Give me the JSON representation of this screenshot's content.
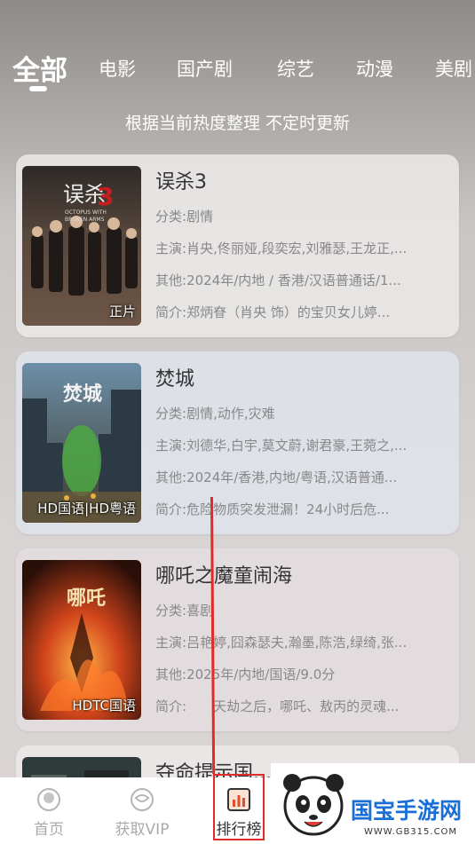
{
  "tabs": [
    "全部",
    "电影",
    "国产剧",
    "综艺",
    "动漫",
    "美剧"
  ],
  "subtitle": "根据当前热度整理 不定时更新",
  "cards": [
    {
      "title": "误杀3",
      "badge": "正片",
      "category_label": "分类:",
      "category": "剧情",
      "cast_label": "主演:",
      "cast": "肖央,佟丽娅,段奕宏,刘雅瑟,王龙正,...",
      "other_label": "其他:",
      "other": "2024年/内地 / 香港/汉语普通话/1...",
      "intro_label": "简介:",
      "intro": "郑炳眘（肖央 饰）的宝贝女儿婷...",
      "poster_text": "误杀",
      "poster_sub": "OCTOPUS WITH BROKEN ARMS",
      "colors": {
        "top": "#2e2a28",
        "bottom": "#8a6a55",
        "accent": "#c61e1e"
      }
    },
    {
      "title": "焚城",
      "badge": "HD国语|HD粤语",
      "category_label": "分类:",
      "category": "剧情,动作,灾难",
      "cast_label": "主演:",
      "cast": "刘德华,白宇,莫文蔚,谢君豪,王菀之,...",
      "other_label": "其他:",
      "other": "2024年/香港,内地/粤语,汉语普通...",
      "intro_label": "简介:",
      "intro": "危险物质突发泄漏！24小时后危...",
      "poster_text": "焚城",
      "colors": {
        "top": "#6d8ea8",
        "bottom": "#3b3a2b",
        "accent": "#4ea843"
      }
    },
    {
      "title": "哪吒之魔童闹海",
      "badge": "HDTC国语",
      "category_label": "分类:",
      "category": "喜剧",
      "cast_label": "主演:",
      "cast": "吕艳婷,囧森瑟夫,瀚墨,陈浩,绿绮,张...",
      "other_label": "其他:",
      "other": "2025年/内地/国语/9.0分",
      "intro_label": "简介:",
      "intro": "　　天劫之后，哪吒、敖丙的灵魂...",
      "poster_text": "哪吒",
      "colors": {
        "top": "#2a0f08",
        "bottom": "#d2451c",
        "accent": "#ffb347"
      }
    },
    {
      "title": "夺命提示国..."
    }
  ],
  "bottom_nav": [
    {
      "label": "首页",
      "icon": "home-icon"
    },
    {
      "label": "获取VIP",
      "icon": "vip-icon"
    },
    {
      "label": "排行榜",
      "icon": "ranking-icon"
    }
  ],
  "watermark": {
    "name": "国宝手游网",
    "url": "WWW.GB315.COM"
  }
}
